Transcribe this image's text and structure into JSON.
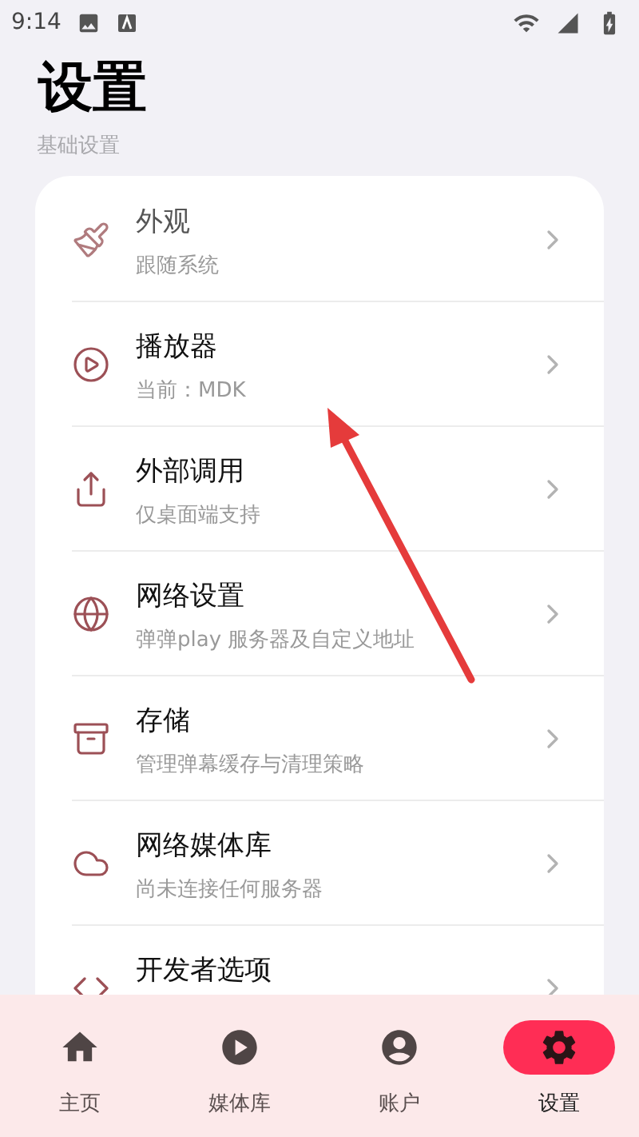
{
  "status_bar": {
    "time": "9:14"
  },
  "title": "设置",
  "section": "基础设置",
  "settings": [
    {
      "title": "外观",
      "subtitle": "跟随系统"
    },
    {
      "title": "播放器",
      "subtitle": "当前：MDK"
    },
    {
      "title": "外部调用",
      "subtitle": "仅桌面端支持"
    },
    {
      "title": "网络设置",
      "subtitle": "弹弹play 服务器及自定义地址"
    },
    {
      "title": "存储",
      "subtitle": "管理弹幕缓存与清理策略"
    },
    {
      "title": "网络媒体库",
      "subtitle": "尚未连接任何服务器"
    },
    {
      "title": "开发者选项"
    }
  ],
  "nav": [
    {
      "label": "主页",
      "selected": false
    },
    {
      "label": "媒体库",
      "selected": false
    },
    {
      "label": "账户",
      "selected": false
    },
    {
      "label": "设置",
      "selected": true
    }
  ]
}
